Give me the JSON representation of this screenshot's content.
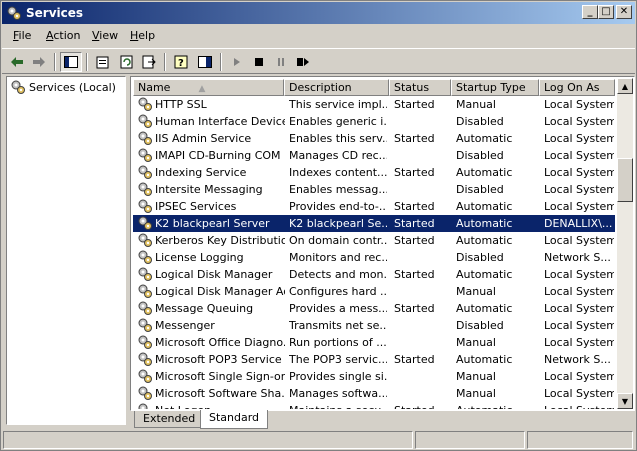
{
  "window": {
    "title": "Services"
  },
  "menu": [
    {
      "label": "File",
      "key": "F",
      "rest": "ile"
    },
    {
      "label": "Action",
      "key": "A",
      "rest": "ction"
    },
    {
      "label": "View",
      "key": "V",
      "rest": "iew"
    },
    {
      "label": "Help",
      "key": "H",
      "rest": "elp"
    }
  ],
  "toolbar": {
    "back_icon": "back-arrow-icon",
    "forward_icon": "forward-arrow-icon",
    "play_icon": "play-icon",
    "stop_icon": "stop-icon",
    "pause_icon": "pause-icon",
    "restart_icon": "restart-icon"
  },
  "tree": {
    "root": "Services (Local)"
  },
  "columns": [
    "Name",
    "Description",
    "Status",
    "Startup Type",
    "Log On As"
  ],
  "rows": [
    [
      "HTTP SSL",
      "This service impl...",
      "Started",
      "Manual",
      "Local System"
    ],
    [
      "Human Interface Device...",
      "Enables generic i...",
      "",
      "Disabled",
      "Local System"
    ],
    [
      "IIS Admin Service",
      "Enables this serv...",
      "Started",
      "Automatic",
      "Local System"
    ],
    [
      "IMAPI CD-Burning COM ...",
      "Manages CD rec...",
      "",
      "Disabled",
      "Local System"
    ],
    [
      "Indexing Service",
      "Indexes content...",
      "Started",
      "Automatic",
      "Local System"
    ],
    [
      "Intersite Messaging",
      "Enables messag...",
      "",
      "Disabled",
      "Local System"
    ],
    [
      "IPSEC Services",
      "Provides end-to-...",
      "Started",
      "Automatic",
      "Local System"
    ],
    [
      "K2 blackpearl  Server",
      "K2 blackpearl Se...",
      "Started",
      "Automatic",
      "DENALLIX\\..."
    ],
    [
      "Kerberos Key Distributio...",
      "On domain contr...",
      "Started",
      "Automatic",
      "Local System"
    ],
    [
      "License Logging",
      "Monitors and rec...",
      "",
      "Disabled",
      "Network S..."
    ],
    [
      "Logical Disk Manager",
      "Detects and mon...",
      "Started",
      "Automatic",
      "Local System"
    ],
    [
      "Logical Disk Manager Ad...",
      "Configures hard ...",
      "",
      "Manual",
      "Local System"
    ],
    [
      "Message Queuing",
      "Provides a mess...",
      "Started",
      "Automatic",
      "Local System"
    ],
    [
      "Messenger",
      "Transmits net se...",
      "",
      "Disabled",
      "Local System"
    ],
    [
      "Microsoft Office Diagno...",
      "Run portions of ...",
      "",
      "Manual",
      "Local System"
    ],
    [
      "Microsoft POP3 Service",
      "The POP3 servic...",
      "Started",
      "Automatic",
      "Network S..."
    ],
    [
      "Microsoft Single Sign-on...",
      "Provides single si...",
      "",
      "Manual",
      "Local System"
    ],
    [
      "Microsoft Software Sha...",
      "Manages softwa...",
      "",
      "Manual",
      "Local System"
    ],
    [
      "Net Logon",
      "Maintains a secu...",
      "Started",
      "Automatic",
      "Local System"
    ]
  ],
  "selected_row": 7,
  "tabs": [
    "Extended",
    "Standard"
  ],
  "active_tab": "Standard"
}
